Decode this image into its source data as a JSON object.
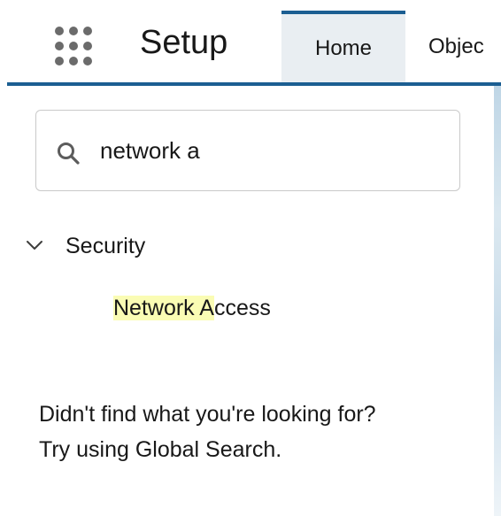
{
  "header": {
    "app_launcher_icon": "app-launcher-grid-icon",
    "title": "Setup",
    "tabs": [
      {
        "label": "Home",
        "active": true
      },
      {
        "label": "Objec"
      }
    ],
    "accent_color": "#1b5e92"
  },
  "search": {
    "icon": "search-icon",
    "value": "network a"
  },
  "tree": {
    "node": {
      "icon": "chevron-down-icon",
      "label": "Security",
      "expanded": true
    },
    "leaf": {
      "match": "Network A",
      "rest": "ccess",
      "highlight_color": "#fafcb4"
    }
  },
  "help": {
    "line1": "Didn't find what you're looking for?",
    "line2": "Try using Global Search."
  }
}
